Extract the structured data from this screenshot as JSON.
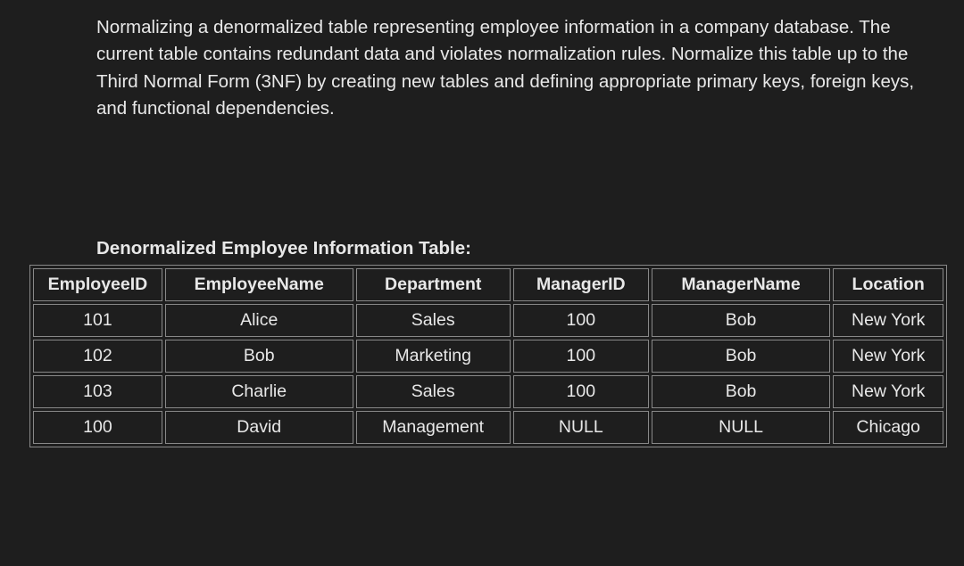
{
  "description": "Normalizing a denormalized table representing employee information in a company database. The current table contains redundant data and violates normalization rules. Normalize this table up to the Third Normal Form (3NF) by creating new tables and defining appropriate primary keys, foreign keys, and functional dependencies.",
  "table_title": "Denormalized Employee Information Table:",
  "table": {
    "headers": [
      "EmployeeID",
      "EmployeeName",
      "Department",
      "ManagerID",
      "ManagerName",
      "Location"
    ],
    "rows": [
      [
        "101",
        "Alice",
        "Sales",
        "100",
        "Bob",
        "New York"
      ],
      [
        "102",
        "Bob",
        "Marketing",
        "100",
        "Bob",
        "New York"
      ],
      [
        "103",
        "Charlie",
        "Sales",
        "100",
        "Bob",
        "New York"
      ],
      [
        "100",
        "David",
        "Management",
        "NULL",
        "NULL",
        "Chicago"
      ]
    ]
  }
}
